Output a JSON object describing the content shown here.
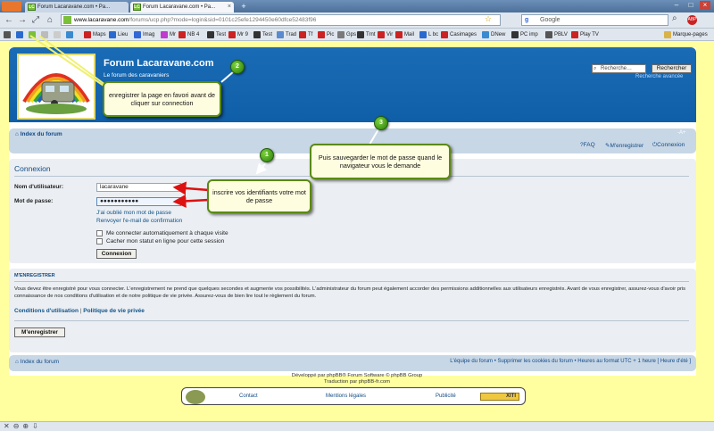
{
  "browser": {
    "tabs": [
      {
        "title": "Forum Lacaravane.com • Pa...",
        "active": false
      },
      {
        "title": "Forum Lacaravane.com • Pa...",
        "active": true
      }
    ],
    "url_host": "www.lacaravane.com",
    "url_path": "/forums/ucp.php?mode=login&sid=0101c25efe1294450e60dfce52483f96",
    "search_engine": "Google",
    "bookmarks": [
      "Maps",
      "Lieu",
      "Imag",
      "Mr",
      "NB 4",
      "Test",
      "Mr 9",
      "Test",
      "Trad",
      "Tf",
      "Pic",
      "Gps",
      "Trnt",
      "Vir",
      "Mail",
      "L bc",
      "Casimages",
      "DNew",
      "PC imp",
      "PBLV",
      "Play TV"
    ],
    "bookmarks_folder": "Marque-pages"
  },
  "header": {
    "site_title": "Forum Lacaravane.com",
    "site_subtitle": "Le forum des caravaniers",
    "search_placeholder": "Recherche…",
    "search_button": "Rechercher",
    "advanced_search": "Recherche avancée",
    "logo_text": "www.lacaravane.com"
  },
  "nav": {
    "home": "Index du forum",
    "faq": "FAQ",
    "register": "M'enregistrer",
    "login": "Connexion"
  },
  "login": {
    "heading": "Connexion",
    "username_label": "Nom d'utilisateur:",
    "username_value": "lacaravane",
    "password_label": "Mot de passe:",
    "password_value": "●●●●●●●●●●●",
    "forgot_password": "J'ai oublié mon mot de passe",
    "resend_email": "Renvoyer l'e-mail de confirmation",
    "autologin_label": "Me connecter automatiquement à chaque visite",
    "hide_status_label": "Cacher mon statut en ligne pour cette session",
    "submit": "Connexion"
  },
  "register": {
    "heading": "M'ENREGISTRER",
    "text": "Vous devez être enregistré pour vous connecter. L'enregistrement ne prend que quelques secondes et augmente vos possibilités. L'administrateur du forum peut également accorder des permissions additionnelles aux utilisateurs enregistrés. Avant de vous enregistrer, assurez-vous d'avoir pris connaissance de nos conditions d'utilisation et de notre politique de vie privée. Assurez-vous de bien lire tout le règlement du forum.",
    "terms_link": "Conditions d'utilisation",
    "privacy_link": "Politique de vie privée",
    "button": "M'enregistrer"
  },
  "footer": {
    "home": "Index du forum",
    "right": "L'équipe du forum • Supprimer les cookies du forum • Heures au format UTC + 1 heure [ Heure d'été ]",
    "credits_line1": "Développé par phpBB® Forum Software © phpBB Group",
    "credits_line2": "Traduction par phpBB-fr.com",
    "links": [
      "Contact",
      "Mentions légales",
      "Publicité"
    ],
    "xiti": "XITI"
  },
  "annotations": {
    "callout1": {
      "number": "1",
      "text": "inscrire vos identifiants votre mot de passe"
    },
    "callout2": {
      "number": "2",
      "text": "enregistrer la page en favori avant de cliquer sur connection"
    },
    "callout3": {
      "number": "3",
      "text": "Puis sauvegarder le mot de passe quand le navigateur vous le demande"
    }
  },
  "colors": {
    "page_bg": "#ffffa0",
    "header_blue": "#1166b0",
    "link": "#105289",
    "callout_border": "#5a8a12",
    "arrow_red": "#dd1111"
  }
}
